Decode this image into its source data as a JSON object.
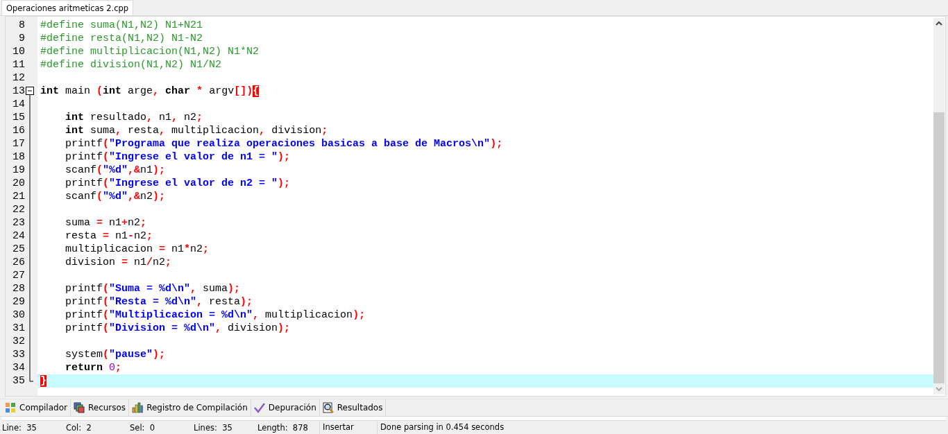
{
  "editor_tabs": [
    {
      "label": "Operaciones aritmeticas 2.cpp",
      "selected": true
    }
  ],
  "lines": [
    {
      "number": "8",
      "current": false,
      "kind": "plain",
      "tokens": [
        {
          "kind": "pre",
          "text": "#define suma(N1,N2) N1+N21"
        }
      ]
    },
    {
      "number": "9",
      "current": false,
      "kind": "plain",
      "tokens": [
        {
          "kind": "pre",
          "text": "#define resta(N1,N2) N1-N2"
        }
      ]
    },
    {
      "number": "10",
      "current": false,
      "kind": "plain",
      "tokens": [
        {
          "kind": "pre",
          "text": "#define multiplicacion(N1,N2) N1*N2"
        }
      ]
    },
    {
      "number": "11",
      "current": false,
      "kind": "plain",
      "tokens": [
        {
          "kind": "pre",
          "text": "#define division(N1,N2) N1/N2"
        }
      ]
    },
    {
      "number": "12",
      "current": false,
      "kind": "plain"
    },
    {
      "number": "13",
      "current": false,
      "kind": "foldstart",
      "tokens": [
        {
          "kind": "kw",
          "text": "int"
        },
        {
          "kind": "id",
          "text": " main "
        },
        {
          "kind": "sym",
          "text": "("
        },
        {
          "kind": "kw",
          "text": "int"
        },
        {
          "kind": "id",
          "text": " arge"
        },
        {
          "kind": "sym",
          "text": ","
        },
        {
          "kind": "kw",
          "text": " char"
        },
        {
          "kind": "sym",
          "text": " *"
        },
        {
          "kind": "id",
          "text": " argv"
        },
        {
          "kind": "sym",
          "text": "[])"
        },
        {
          "kind": "match",
          "text": "{"
        }
      ]
    },
    {
      "number": "14",
      "current": false,
      "kind": "foldbody"
    },
    {
      "number": "15",
      "current": false,
      "kind": "foldbody",
      "tokens": [
        {
          "kind": "kw",
          "text": "    int"
        },
        {
          "kind": "id",
          "text": " resultado"
        },
        {
          "kind": "sym",
          "text": ","
        },
        {
          "kind": "id",
          "text": " n1"
        },
        {
          "kind": "sym",
          "text": ","
        },
        {
          "kind": "id",
          "text": " n2"
        },
        {
          "kind": "sym",
          "text": ";"
        }
      ]
    },
    {
      "number": "16",
      "current": false,
      "kind": "foldbody",
      "tokens": [
        {
          "kind": "kw",
          "text": "    int"
        },
        {
          "kind": "id",
          "text": " suma"
        },
        {
          "kind": "sym",
          "text": ","
        },
        {
          "kind": "id",
          "text": " resta"
        },
        {
          "kind": "sym",
          "text": ","
        },
        {
          "kind": "id",
          "text": " multiplicacion"
        },
        {
          "kind": "sym",
          "text": ","
        },
        {
          "kind": "id",
          "text": " division"
        },
        {
          "kind": "sym",
          "text": ";"
        }
      ]
    },
    {
      "number": "17",
      "current": false,
      "kind": "foldbody",
      "tokens": [
        {
          "kind": "id",
          "text": "    printf"
        },
        {
          "kind": "sym",
          "text": "("
        },
        {
          "kind": "str",
          "text": "\"Programa que realiza operaciones basicas a base de Macros\\n\""
        },
        {
          "kind": "sym",
          "text": ");"
        }
      ]
    },
    {
      "number": "18",
      "current": false,
      "kind": "foldbody",
      "tokens": [
        {
          "kind": "id",
          "text": "    printf"
        },
        {
          "kind": "sym",
          "text": "("
        },
        {
          "kind": "str",
          "text": "\"Ingrese el valor de n1 = \""
        },
        {
          "kind": "sym",
          "text": ");"
        }
      ]
    },
    {
      "number": "19",
      "current": false,
      "kind": "foldbody",
      "tokens": [
        {
          "kind": "id",
          "text": "    scanf"
        },
        {
          "kind": "sym",
          "text": "("
        },
        {
          "kind": "str",
          "text": "\"%d\""
        },
        {
          "kind": "sym",
          "text": ",&"
        },
        {
          "kind": "id",
          "text": "n1"
        },
        {
          "kind": "sym",
          "text": ");"
        }
      ]
    },
    {
      "number": "20",
      "current": false,
      "kind": "foldbody",
      "tokens": [
        {
          "kind": "id",
          "text": "    printf"
        },
        {
          "kind": "sym",
          "text": "("
        },
        {
          "kind": "str",
          "text": "\"Ingrese el valor de n2 = \""
        },
        {
          "kind": "sym",
          "text": ");"
        }
      ]
    },
    {
      "number": "21",
      "current": false,
      "kind": "foldbody",
      "tokens": [
        {
          "kind": "id",
          "text": "    scanf"
        },
        {
          "kind": "sym",
          "text": "("
        },
        {
          "kind": "str",
          "text": "\"%d\""
        },
        {
          "kind": "sym",
          "text": ",&"
        },
        {
          "kind": "id",
          "text": "n2"
        },
        {
          "kind": "sym",
          "text": ");"
        }
      ]
    },
    {
      "number": "22",
      "current": false,
      "kind": "foldbody"
    },
    {
      "number": "23",
      "current": false,
      "kind": "foldbody",
      "tokens": [
        {
          "kind": "id",
          "text": "    suma "
        },
        {
          "kind": "sym",
          "text": "="
        },
        {
          "kind": "id",
          "text": " n1"
        },
        {
          "kind": "sym",
          "text": "+"
        },
        {
          "kind": "id",
          "text": "n2"
        },
        {
          "kind": "sym",
          "text": ";"
        }
      ]
    },
    {
      "number": "24",
      "current": false,
      "kind": "foldbody",
      "tokens": [
        {
          "kind": "id",
          "text": "    resta "
        },
        {
          "kind": "sym",
          "text": "="
        },
        {
          "kind": "id",
          "text": " n1"
        },
        {
          "kind": "sym",
          "text": "-"
        },
        {
          "kind": "id",
          "text": "n2"
        },
        {
          "kind": "sym",
          "text": ";"
        }
      ]
    },
    {
      "number": "25",
      "current": false,
      "kind": "foldbody",
      "tokens": [
        {
          "kind": "id",
          "text": "    multiplicacion "
        },
        {
          "kind": "sym",
          "text": "="
        },
        {
          "kind": "id",
          "text": " n1"
        },
        {
          "kind": "sym",
          "text": "*"
        },
        {
          "kind": "id",
          "text": "n2"
        },
        {
          "kind": "sym",
          "text": ";"
        }
      ]
    },
    {
      "number": "26",
      "current": false,
      "kind": "foldbody",
      "tokens": [
        {
          "kind": "id",
          "text": "    division "
        },
        {
          "kind": "sym",
          "text": "="
        },
        {
          "kind": "id",
          "text": " n1"
        },
        {
          "kind": "sym",
          "text": "/"
        },
        {
          "kind": "id",
          "text": "n2"
        },
        {
          "kind": "sym",
          "text": ";"
        }
      ]
    },
    {
      "number": "27",
      "current": false,
      "kind": "foldbody"
    },
    {
      "number": "28",
      "current": false,
      "kind": "foldbody",
      "tokens": [
        {
          "kind": "id",
          "text": "    printf"
        },
        {
          "kind": "sym",
          "text": "("
        },
        {
          "kind": "str",
          "text": "\"Suma = %d\\n\""
        },
        {
          "kind": "sym",
          "text": ","
        },
        {
          "kind": "id",
          "text": " suma"
        },
        {
          "kind": "sym",
          "text": ");"
        }
      ]
    },
    {
      "number": "29",
      "current": false,
      "kind": "foldbody",
      "tokens": [
        {
          "kind": "id",
          "text": "    printf"
        },
        {
          "kind": "sym",
          "text": "("
        },
        {
          "kind": "str",
          "text": "\"Resta = %d\\n\""
        },
        {
          "kind": "sym",
          "text": ","
        },
        {
          "kind": "id",
          "text": " resta"
        },
        {
          "kind": "sym",
          "text": ");"
        }
      ]
    },
    {
      "number": "30",
      "current": false,
      "kind": "foldbody",
      "tokens": [
        {
          "kind": "id",
          "text": "    printf"
        },
        {
          "kind": "sym",
          "text": "("
        },
        {
          "kind": "str",
          "text": "\"Multiplicacion = %d\\n\""
        },
        {
          "kind": "sym",
          "text": ","
        },
        {
          "kind": "id",
          "text": " multiplicacion"
        },
        {
          "kind": "sym",
          "text": ");"
        }
      ]
    },
    {
      "number": "31",
      "current": false,
      "kind": "foldbody",
      "tokens": [
        {
          "kind": "id",
          "text": "    printf"
        },
        {
          "kind": "sym",
          "text": "("
        },
        {
          "kind": "str",
          "text": "\"Division = %d\\n\""
        },
        {
          "kind": "sym",
          "text": ","
        },
        {
          "kind": "id",
          "text": " division"
        },
        {
          "kind": "sym",
          "text": ");"
        }
      ]
    },
    {
      "number": "32",
      "current": false,
      "kind": "foldbody"
    },
    {
      "number": "33",
      "current": false,
      "kind": "foldbody",
      "tokens": [
        {
          "kind": "id",
          "text": "    system"
        },
        {
          "kind": "sym",
          "text": "("
        },
        {
          "kind": "str",
          "text": "\"pause\""
        },
        {
          "kind": "sym",
          "text": ");"
        }
      ]
    },
    {
      "number": "34",
      "current": false,
      "kind": "foldbody",
      "tokens": [
        {
          "kind": "kw",
          "text": "    return"
        },
        {
          "kind": "num",
          "text": " 0"
        },
        {
          "kind": "sym",
          "text": ";"
        }
      ]
    },
    {
      "number": "35",
      "current": true,
      "kind": "foldend",
      "tokens": [
        {
          "kind": "match",
          "text": "}"
        }
      ]
    }
  ],
  "bottom_tabs": [
    {
      "label": "Compilador",
      "kind": "grid"
    },
    {
      "label": "Recursos",
      "kind": "resources"
    },
    {
      "label": "Registro de Compilación",
      "kind": "bars"
    },
    {
      "label": "Depuración",
      "kind": "check"
    },
    {
      "label": "Resultados",
      "kind": "magnifier"
    }
  ],
  "status_bar": {
    "fields": [
      {
        "label": "Line:",
        "value": "35"
      },
      {
        "label": "Col:",
        "value": "2"
      },
      {
        "label": "Sel:",
        "value": "0"
      },
      {
        "label": "Lines:",
        "value": "35"
      },
      {
        "label": "Length:",
        "value": "878"
      }
    ],
    "mode": "Insertar",
    "message": "Done parsing in 0.454 seconds"
  }
}
